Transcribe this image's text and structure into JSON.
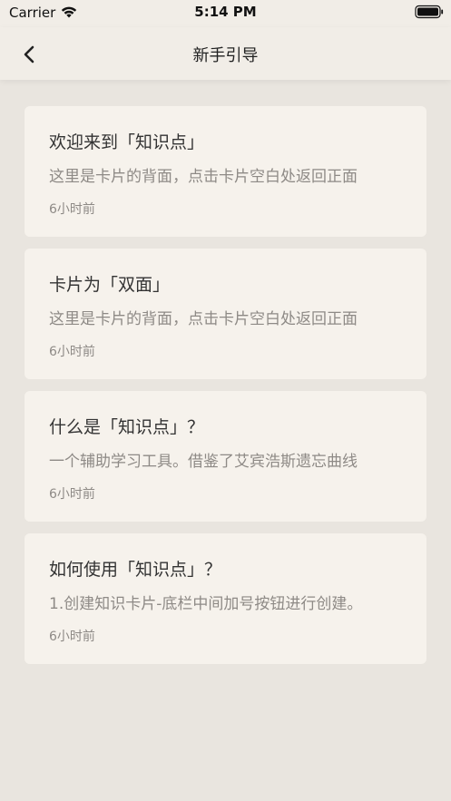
{
  "status_bar": {
    "carrier": "Carrier",
    "time": "5:14 PM",
    "wifi_icon": "wifi-icon",
    "battery_icon": "battery-icon"
  },
  "nav": {
    "back_icon": "chevron-left-icon",
    "title": "新手引导"
  },
  "colors": {
    "background": "#e9e5df",
    "card": "#f6f2ec",
    "title_text": "#333333",
    "secondary_text": "#8e8a86"
  },
  "cards": [
    {
      "title": "欢迎来到「知识点」",
      "preview": "这里是卡片的背面，点击卡片空白处返回正面",
      "time": "6小时前"
    },
    {
      "title": "卡片为「双面」",
      "preview": "这里是卡片的背面，点击卡片空白处返回正面",
      "time": "6小时前"
    },
    {
      "title": "什么是「知识点」？",
      "preview": "一个辅助学习工具。借鉴了艾宾浩斯遗忘曲线",
      "time": "6小时前"
    },
    {
      "title": "如何使用「知识点」？",
      "preview": "1.创建知识卡片-底栏中间加号按钮进行创建。",
      "time": "6小时前"
    }
  ]
}
